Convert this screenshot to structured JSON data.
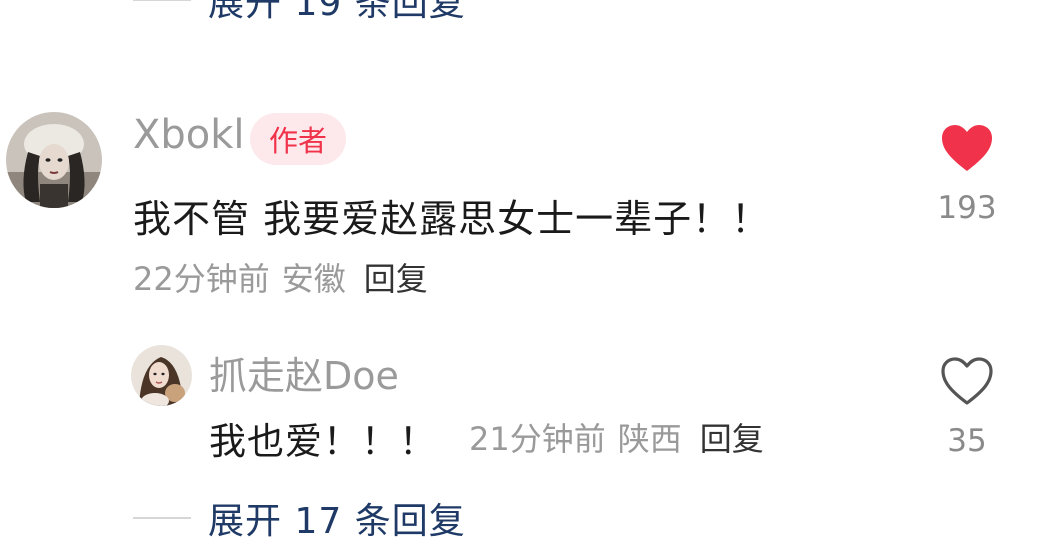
{
  "expand_top": {
    "label": "展开 19 条回复"
  },
  "comment": {
    "username": "Xbokl",
    "author_badge": "作者",
    "text": "我不管 我要爱赵露思女士一辈子！！",
    "time": "22分钟前",
    "location": "安徽",
    "reply_label": "回复",
    "like_count": "193",
    "liked": true,
    "like_color": "#f0324b"
  },
  "reply": {
    "username": "抓走赵Doe",
    "text": "我也爱！！！",
    "time": "21分钟前",
    "location": "陕西",
    "reply_label": "回复",
    "like_count": "35",
    "liked": false
  },
  "expand_bottom": {
    "label": "展开 17 条回复"
  }
}
